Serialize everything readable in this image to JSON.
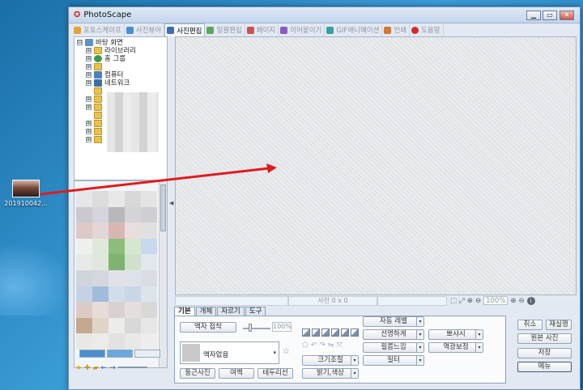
{
  "desktop": {
    "icon_label": "201910042..."
  },
  "window": {
    "logo": "✪",
    "title": "PhotoScape",
    "controls": {
      "minimize": "▁",
      "maximize": "▭",
      "close": "✕"
    }
  },
  "tabs": [
    {
      "label": "포토스케이프",
      "color": "#e3a23a"
    },
    {
      "label": "사진뷰어",
      "color": "#4b8fd0"
    },
    {
      "label": "사진편집",
      "color": "#3c6eb8",
      "active": true
    },
    {
      "label": "일괄편집",
      "color": "#5aa85a"
    },
    {
      "label": "페이지",
      "color": "#d05050"
    },
    {
      "label": "이어붙이기",
      "color": "#8a5bc0"
    },
    {
      "label": "GIF애니메이션",
      "color": "#3aa0a0"
    },
    {
      "label": "인쇄",
      "color": "#d0783a"
    },
    {
      "label": "도움말",
      "color": "#d02a2a"
    }
  ],
  "explorer": {
    "root": "바탕 화면",
    "items": [
      "라이브러리",
      "홈 그룹",
      "",
      "컴퓨터",
      "네트워크"
    ],
    "expand_symbol": "⊞",
    "collapse_symbol": "⊟"
  },
  "statusbar": {
    "photo_info": "사진 0 x 0",
    "zoom_value": "100%"
  },
  "edit_tabs": {
    "basic": "기본",
    "object": "개체",
    "crop": "자르기",
    "tools": "도구"
  },
  "basic_panel": {
    "frame_fit_button": "액자 접착",
    "frame_pct": "100%",
    "frame_select": "액자없음",
    "round_photo_button": "둥근사진",
    "margin_button": "여백",
    "border_button": "테두리선",
    "resize_button": "크기조절",
    "brightness_button": "밝기,색상",
    "auto_level_button": "자동 레벨",
    "sharpen_button": "선명하게",
    "film_effect_button": "필름느낌",
    "filter_button": "필터",
    "bloom_button": "뽀샤시",
    "backlight_button": "역광보정"
  },
  "right_buttons": {
    "cancel": "취소",
    "redo": "재실행",
    "original": "원본 사진",
    "save": "저장",
    "menu": "메뉴"
  },
  "colors": {
    "desktop": "#2a86c4",
    "arrow": "#e01c1c",
    "window_frame": "#6d8db6"
  }
}
